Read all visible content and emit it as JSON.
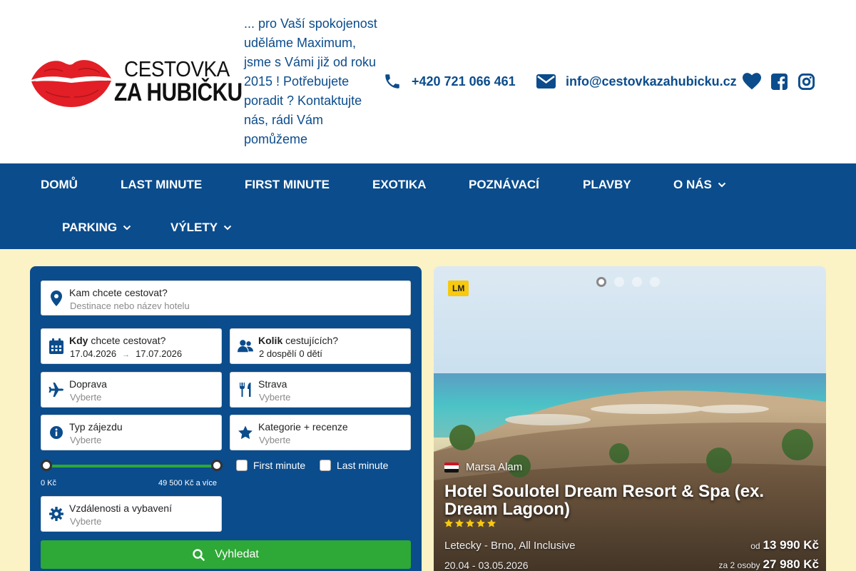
{
  "header": {
    "logo_line1": "CESTOVKA",
    "logo_line2": "ZA HUBIČKU",
    "tagline": "... pro Vaší spokojenost uděláme Maximum, jsme s Vámi již od roku 2015 ! Potřebujete poradit ? Kontaktujte nás, rádi Vám pomůžeme",
    "phone": "+420 721 066 461",
    "email": "info@cestovkazahubicku.cz",
    "social_icons": [
      "heart-icon",
      "facebook-icon",
      "instagram-icon"
    ]
  },
  "nav": {
    "items": [
      {
        "label": "DOMŮ",
        "dropdown": false
      },
      {
        "label": "LAST MINUTE",
        "dropdown": false
      },
      {
        "label": "FIRST MINUTE",
        "dropdown": false
      },
      {
        "label": "EXOTIKA",
        "dropdown": false
      },
      {
        "label": "POZNÁVACÍ",
        "dropdown": false
      },
      {
        "label": "PLAVBY",
        "dropdown": false
      },
      {
        "label": "O NÁS",
        "dropdown": true
      },
      {
        "label": "PARKING",
        "dropdown": true
      },
      {
        "label": "VÝLETY",
        "dropdown": true
      }
    ]
  },
  "search": {
    "destination": {
      "label": "Kam chcete cestovat?",
      "placeholder": "Destinace nebo název hotelu"
    },
    "when": {
      "label_bold": "Kdy",
      "label_rest": " chcete cestovat?",
      "date_from": "17.04.2026",
      "date_to": "17.07.2026"
    },
    "travelers": {
      "label_bold": "Kolik",
      "label_rest": " cestujících?",
      "value": "2 dospělí 0 dětí"
    },
    "transport": {
      "label": "Doprava",
      "value": "Vyberte"
    },
    "board": {
      "label": "Strava",
      "value": "Vyberte"
    },
    "tour_type": {
      "label": "Typ zájezdu",
      "value": "Vyberte"
    },
    "category": {
      "label": "Kategorie + recenze",
      "value": "Vyberte"
    },
    "price": {
      "min_label": "0 Kč",
      "max_label": "49 500 Kč a více",
      "min_fraction": 0.0,
      "max_fraction": 1.0
    },
    "first_minute": {
      "label": "First minute",
      "checked": false
    },
    "last_minute": {
      "label": "Last minute",
      "checked": false
    },
    "distances": {
      "label": "Vzdálenosti a vybavení",
      "value": "Vyberte"
    },
    "button_label": "Vyhledat"
  },
  "offer": {
    "badge": "LM",
    "slides_total": 4,
    "slide_active": 1,
    "destination": "Marsa Alam",
    "hotel_name": "Hotel Soulotel Dream Resort & Spa (ex. Dream Lagoon)",
    "stars": 5,
    "transport_info": "Letecky - Brno, All Inclusive",
    "dates": "20.04 - 03.05.2026",
    "price_prefix": "od",
    "price": "13 990 Kč",
    "total_prefix": "za 2 osoby",
    "total_price": "27 980 Kč"
  },
  "colors": {
    "primary": "#0b4c8c",
    "accent_green": "#2ea836",
    "background": "#fbf2c6",
    "lips_red": "#e21f26",
    "badge_yellow": "#f7c90f"
  }
}
